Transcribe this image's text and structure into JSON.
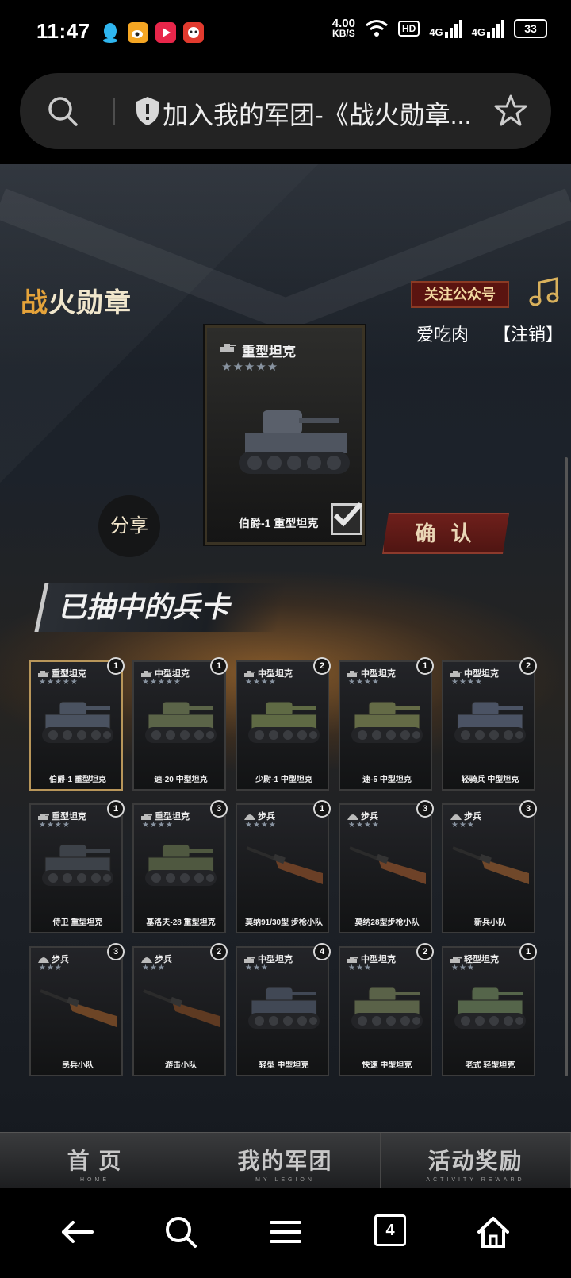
{
  "status": {
    "time": "11:47",
    "speed_value": "4.00",
    "speed_unit": "KB/S",
    "hd": "HD",
    "net1": "4G",
    "net2": "4G",
    "battery": "33"
  },
  "browser": {
    "title": "加入我的军团-《战火勋章..."
  },
  "header": {
    "logo_part1": "战",
    "logo_part2": "火勋章",
    "follow_label": "关注公众号",
    "username": "爱吃肉",
    "logout_label": "【注销】"
  },
  "featured": {
    "type": "重型坦克",
    "stars": "★★★★★",
    "name": "伯爵-1 重型坦克",
    "confirm_label": "确 认",
    "share_label": "分享"
  },
  "section_title": "已抽中的兵卡",
  "cards": [
    {
      "type": "重型坦克",
      "stars": "★★★★★",
      "name": "伯爵-1 重型坦克",
      "count": "1",
      "kind": "tank",
      "color": "#4a5260"
    },
    {
      "type": "中型坦克",
      "stars": "★★★★★",
      "name": "速-20 中型坦克",
      "count": "1",
      "kind": "tank",
      "color": "#5b6448"
    },
    {
      "type": "中型坦克",
      "stars": "★★★★",
      "name": "少尉-1 中型坦克",
      "count": "2",
      "kind": "tank",
      "color": "#5f6a44"
    },
    {
      "type": "中型坦克",
      "stars": "★★★★",
      "name": "速-5 中型坦克",
      "count": "1",
      "kind": "tank",
      "color": "#646b46"
    },
    {
      "type": "中型坦克",
      "stars": "★★★★",
      "name": "轻骑兵 中型坦克",
      "count": "2",
      "kind": "tank",
      "color": "#4b5364"
    },
    {
      "type": "重型坦克",
      "stars": "★★★★",
      "name": "侍卫 重型坦克",
      "count": "1",
      "kind": "tank",
      "color": "#3d4249"
    },
    {
      "type": "重型坦克",
      "stars": "★★★★",
      "name": "基洛夫-28 重型坦克",
      "count": "3",
      "kind": "tank",
      "color": "#4f5840"
    },
    {
      "type": "步兵",
      "stars": "★★★★",
      "name": "莫纳91/30型 步枪小队",
      "count": "1",
      "kind": "rifle",
      "color": "#6a3f26"
    },
    {
      "type": "步兵",
      "stars": "★★★★",
      "name": "莫纳28型步枪小队",
      "count": "3",
      "kind": "rifle",
      "color": "#6e4228"
    },
    {
      "type": "步兵",
      "stars": "★★★",
      "name": "新兵小队",
      "count": "3",
      "kind": "rifle",
      "color": "#70482a"
    },
    {
      "type": "步兵",
      "stars": "★★★",
      "name": "民兵小队",
      "count": "3",
      "kind": "rifle",
      "color": "#6d4526"
    },
    {
      "type": "步兵",
      "stars": "★★★",
      "name": "游击小队",
      "count": "2",
      "kind": "rifle",
      "color": "#5e3a22"
    },
    {
      "type": "中型坦克",
      "stars": "★★★",
      "name": "轻型 中型坦克",
      "count": "4",
      "kind": "tank",
      "color": "#414855"
    },
    {
      "type": "中型坦克",
      "stars": "★★★",
      "name": "快速 中型坦克",
      "count": "2",
      "kind": "tank",
      "color": "#5a6248"
    },
    {
      "type": "轻型坦克",
      "stars": "★★★",
      "name": "老式 轻型坦克",
      "count": "1",
      "kind": "tank",
      "color": "#55654a"
    }
  ],
  "tabs": [
    {
      "label": "首 页",
      "sub": "HOME"
    },
    {
      "label": "我的军团",
      "sub": "MY LEGION"
    },
    {
      "label": "活动奖励",
      "sub": "ACTIVITY REWARD"
    }
  ],
  "nav": {
    "tab_count": "4"
  }
}
